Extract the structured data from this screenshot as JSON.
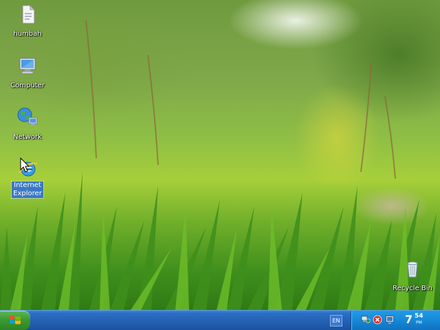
{
  "desktop": {
    "icons": [
      {
        "label": "humbah",
        "icon": "document-icon"
      },
      {
        "label": "Computer",
        "icon": "computer-icon"
      },
      {
        "label": "Network",
        "icon": "network-icon"
      },
      {
        "label": "Internet Explorer",
        "icon": "internet-explorer-icon",
        "selected": true
      },
      {
        "label": "Recycle Bin",
        "icon": "recycle-bin-icon"
      }
    ]
  },
  "taskbar": {
    "start_icon": "windows-logo-icon",
    "language": "EN",
    "tray_icons": [
      "network-shield-icon",
      "error-icon",
      "monitor-icon"
    ],
    "clock": {
      "hour": "7",
      "minute": "54",
      "ampm": "PM"
    }
  },
  "colors": {
    "taskbar": "#245fb1",
    "tray": "#1688d6",
    "start_button": "#3c9a33",
    "selection": "#3a78c4"
  }
}
